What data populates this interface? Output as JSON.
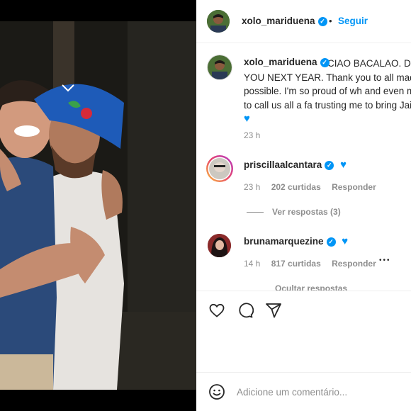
{
  "header": {
    "username": "xolo_mariduena",
    "separator": "•",
    "follow_label": "Seguir"
  },
  "caption": {
    "username": "xolo_mariduena",
    "text": "CIAO BACALAO. DO SEE YOU NEXT YEAR. Thank you to all made this possible. I'm so proud of wh and even more proud to call us all a fa trusting me to bring Jaime to life.",
    "time": "23 h"
  },
  "comments": [
    {
      "username": "priscillaalcantara",
      "time": "23 h",
      "likes": "202 curtidas",
      "reply_label": "Responder",
      "view_replies": "Ver respostas (3)"
    },
    {
      "username": "brunamarquezine",
      "time": "14 h",
      "likes": "817 curtidas",
      "reply_label": "Responder",
      "more": "•••",
      "hide_replies": "Ocultar respostas"
    }
  ],
  "add_comment_placeholder": "Adicione um comentário...",
  "icons": {
    "like": "heart-icon",
    "comment": "comment-icon",
    "share": "share-icon",
    "emoji": "emoji-icon",
    "verified": "verified-badge-icon"
  },
  "colors": {
    "accent": "#0095f6",
    "text": "#262626",
    "muted": "#8e8e8e"
  }
}
